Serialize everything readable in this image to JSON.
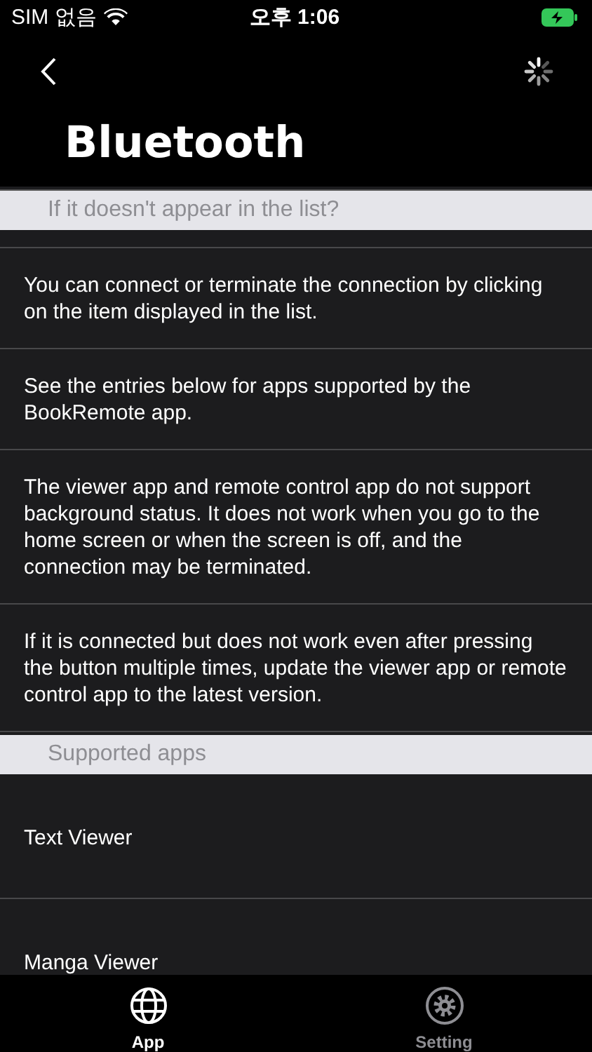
{
  "status_bar": {
    "carrier": "SIM 없음",
    "time": "오후 1:06"
  },
  "nav": {
    "title": "Bluetooth"
  },
  "sections": [
    {
      "header": "If it doesn't appear in the list?",
      "items": [
        {
          "kind": "info",
          "text": "You can connect or terminate the connection by clicking on the item displayed in the list."
        },
        {
          "kind": "info",
          "text": "See the entries below for apps supported by the BookRemote app."
        },
        {
          "kind": "info",
          "text": "The viewer app and remote control app do not support background status. It does not work when you go to the home screen or when the screen is off, and the connection may be terminated."
        },
        {
          "kind": "info",
          "text": "If it is connected but does not work even after pressing the button multiple times, update the viewer app or remote control app to the latest version."
        }
      ]
    },
    {
      "header": "Supported apps",
      "items": [
        {
          "kind": "app",
          "text": "Text Viewer"
        },
        {
          "kind": "app",
          "text": "Manga Viewer"
        }
      ]
    }
  ],
  "tabs": [
    {
      "label": "App",
      "selected": true
    },
    {
      "label": "Setting",
      "selected": false
    }
  ]
}
